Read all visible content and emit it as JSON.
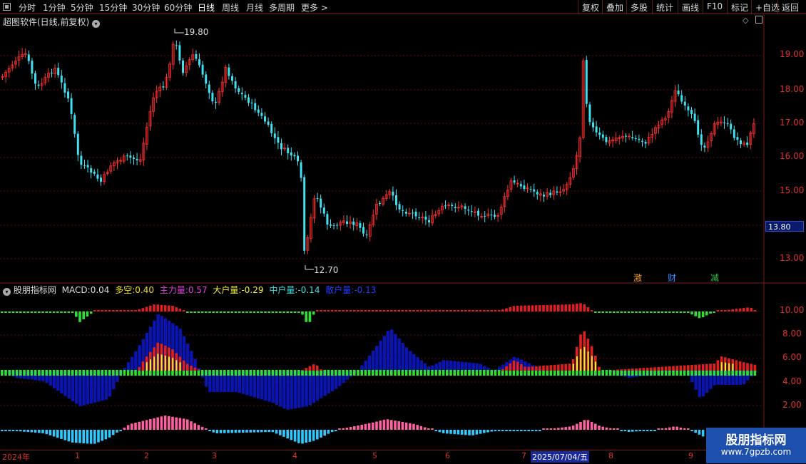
{
  "toolbar": {
    "periods": [
      "分时",
      "1分钟",
      "5分钟",
      "15分钟",
      "30分钟",
      "60分钟",
      "日线",
      "周线",
      "月线",
      "多周期",
      "更多"
    ],
    "right_buttons": [
      "复权",
      "叠加",
      "多股",
      "统计",
      "画线",
      "F10",
      "标记",
      "+自选",
      "返回"
    ]
  },
  "main_panel": {
    "title": "超图软件(日线,前复权)",
    "price_axis": [
      "19.00",
      "18.00",
      "17.00",
      "16.00",
      "15.00",
      "13.00"
    ],
    "current_price": "13.80",
    "high_annotation": "19.80",
    "low_annotation": "12.70",
    "markers": [
      {
        "text": "激",
        "color": "#f0a020"
      },
      {
        "text": "财",
        "color": "#3a8aff"
      },
      {
        "text": "减",
        "color": "#30c040"
      }
    ]
  },
  "indicator_panel": {
    "name": "股朋指标网",
    "values": [
      {
        "label": "MACD:",
        "value": "0.04",
        "color": "#dddddd"
      },
      {
        "label": "多空:",
        "value": "0.40",
        "color": "#f0e020"
      },
      {
        "label": "主力量:",
        "value": "0.57",
        "color": "#e040e0"
      },
      {
        "label": "大户量:",
        "value": "-0.29",
        "color": "#f0f040"
      },
      {
        "label": "中户量:",
        "value": "-0.14",
        "color": "#40e0e0"
      },
      {
        "label": "散户量:",
        "value": "-0.13",
        "color": "#2040ff"
      }
    ],
    "axis": [
      "10.00",
      "8.00",
      "6.00",
      "4.00",
      "2.00"
    ]
  },
  "date_axis": {
    "labels": [
      "2024年",
      "1",
      "2",
      "3",
      "4",
      "5",
      "6",
      "7",
      "8",
      "9"
    ],
    "cursor_date": "2025/07/04/五"
  },
  "watermark": {
    "title": "股朋指标网",
    "url": "www.7gpzb.com"
  },
  "colors": {
    "up": "#ff3030",
    "down": "#40e0f0",
    "frame": "#7a1a1a"
  }
}
